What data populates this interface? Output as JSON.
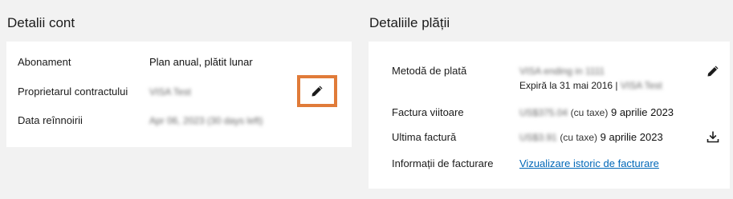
{
  "account": {
    "title": "Detalii cont",
    "rows": [
      {
        "label": "Abonament",
        "value": "Plan anual, plătit lunar"
      },
      {
        "label": "Proprietarul contractului",
        "value": "VISA Test"
      },
      {
        "label": "Data reînnoirii",
        "value": "Apr 06, 2023 (30 days left)"
      }
    ],
    "edit_icon": "pencil-icon",
    "highlight_color": "#e07b39"
  },
  "payment": {
    "title": "Detaliile plății",
    "method_label": "Metodă de plată",
    "method_value": "VISA ending in 1111",
    "expiry_text": "Expiră la 31 mai 2016 |",
    "expiry_owner": "VISA Test",
    "next_invoice_label": "Factura viitoare",
    "next_invoice_amount": "US$375.04",
    "next_invoice_tax": "(cu taxe)",
    "next_invoice_date": "9 aprilie 2023",
    "last_invoice_label": "Ultima factură",
    "last_invoice_amount": "US$3.91",
    "last_invoice_tax": "(cu taxe)",
    "last_invoice_date": "9 aprilie 2023",
    "billing_info_label": "Informații de facturare",
    "billing_history_link": "Vizualizare istoric de facturare",
    "edit_icon": "pencil-icon",
    "download_icon": "download-icon",
    "link_color": "#0067b8"
  }
}
